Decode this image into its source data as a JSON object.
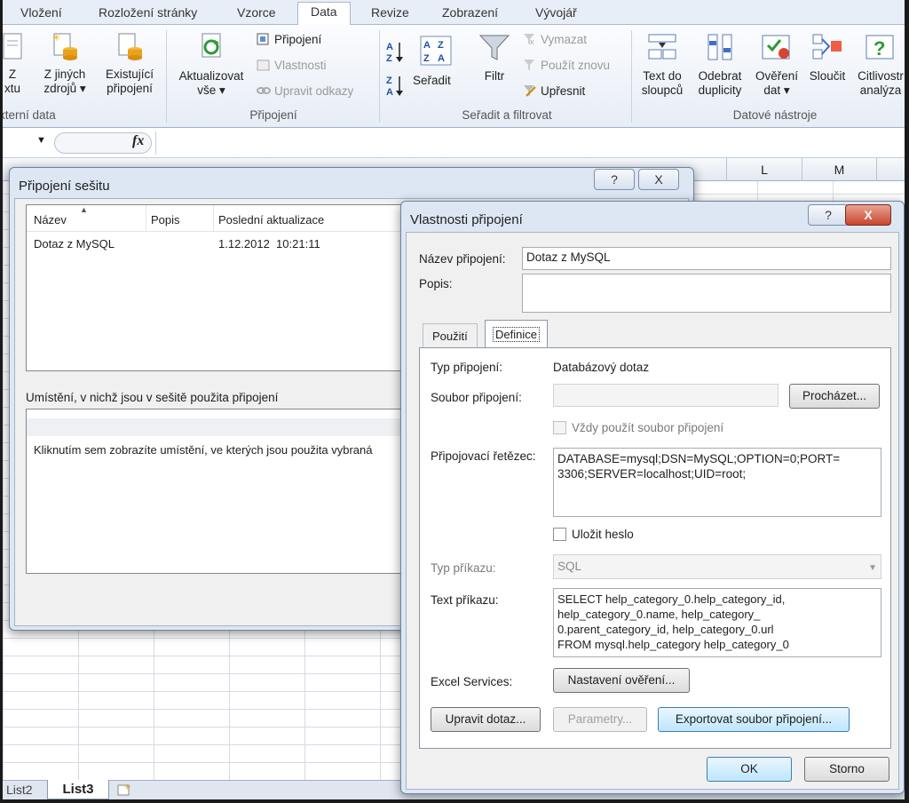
{
  "ribbon": {
    "tabs": [
      "Vložení",
      "Rozložení stránky",
      "Vzorce",
      "Data",
      "Revize",
      "Zobrazení",
      "Vývojář"
    ],
    "active_tab": "Data",
    "external_data": {
      "btn_text_line1": "Z",
      "btn_text_line2": "xtu",
      "btn_other_line1": "Z jiných",
      "btn_other_line2": "zdrojů ▾",
      "btn_existing_line1": "Existující",
      "btn_existing_line2": "připojení",
      "group_label": "xterní data"
    },
    "connections": {
      "refresh_line1": "Aktualizovat",
      "refresh_line2": "vše ▾",
      "connections": "Připojení",
      "properties": "Vlastnosti",
      "edit_links": "Upravit odkazy",
      "group_label": "Připojení"
    },
    "sort_filter": {
      "sort": "Seřadit",
      "filter": "Filtr",
      "clear": "Vymazat",
      "reapply": "Použít znovu",
      "advanced": "Upřesnit",
      "group_label": "Seřadit a filtrovat"
    },
    "data_tools": {
      "text_to_cols_line1": "Text do",
      "text_to_cols_line2": "sloupců",
      "remove_dup_line1": "Odebrat",
      "remove_dup_line2": "duplicity",
      "validation_line1": "Ověření",
      "validation_line2": "dat ▾",
      "consolidate": "Sloučit",
      "whatif_line1": "Citlivostr",
      "whatif_line2": "analýza",
      "group_label": "Datové nástroje"
    }
  },
  "formula_bar": {
    "fx": "fx"
  },
  "columns": [
    "L",
    "M"
  ],
  "sheet_tabs": [
    "List2",
    "List3"
  ],
  "workbook_connections": {
    "title": "Připojení sešitu",
    "help": "?",
    "close": "X",
    "columns": [
      "Název",
      "Popis",
      "Poslední aktualizace"
    ],
    "rows": [
      {
        "name": "Dotaz z MySQL",
        "desc": "",
        "updated": "1.12.2012  10:21:11"
      }
    ],
    "locations_label": "Umístění, v nichž jsou v sešitě použita připojení",
    "locations_hint": "Kliknutím sem zobrazíte umístění, ve kterých jsou použita vybraná"
  },
  "properties": {
    "title": "Vlastnosti připojení",
    "help": "?",
    "close": "X",
    "name_label": "Název připojení:",
    "name_value": "Dotaz z MySQL",
    "desc_label": "Popis:",
    "desc_value": "",
    "tabs": [
      "Použití",
      "Definice"
    ],
    "active_tab": "Definice",
    "conn_type_label": "Typ připojení:",
    "conn_type_value": "Databázový dotaz",
    "conn_file_label": "Soubor připojení:",
    "conn_file_value": "",
    "browse": "Procházet...",
    "always_use_file": "Vždy použít soubor připojení",
    "conn_string_label": "Připojovací řetězec:",
    "conn_string_value": "DATABASE=mysql;DSN=MySQL;OPTION=0;PORT=\n3306;SERVER=localhost;UID=root;",
    "save_password": "Uložit heslo",
    "command_type_label": "Typ příkazu:",
    "command_type_value": "SQL",
    "command_text_label": "Text příkazu:",
    "command_text_value": "SELECT help_category_0.help_category_id,\nhelp_category_0.name, help_category_\n0.parent_category_id, help_category_0.url\nFROM mysql.help_category help_category_0",
    "excel_services_label": "Excel Services:",
    "auth_settings": "Nastavení ověření...",
    "edit_query": "Upravit dotaz...",
    "parameters": "Parametry...",
    "export_file": "Exportovat soubor připojení...",
    "ok": "OK",
    "cancel": "Storno"
  }
}
